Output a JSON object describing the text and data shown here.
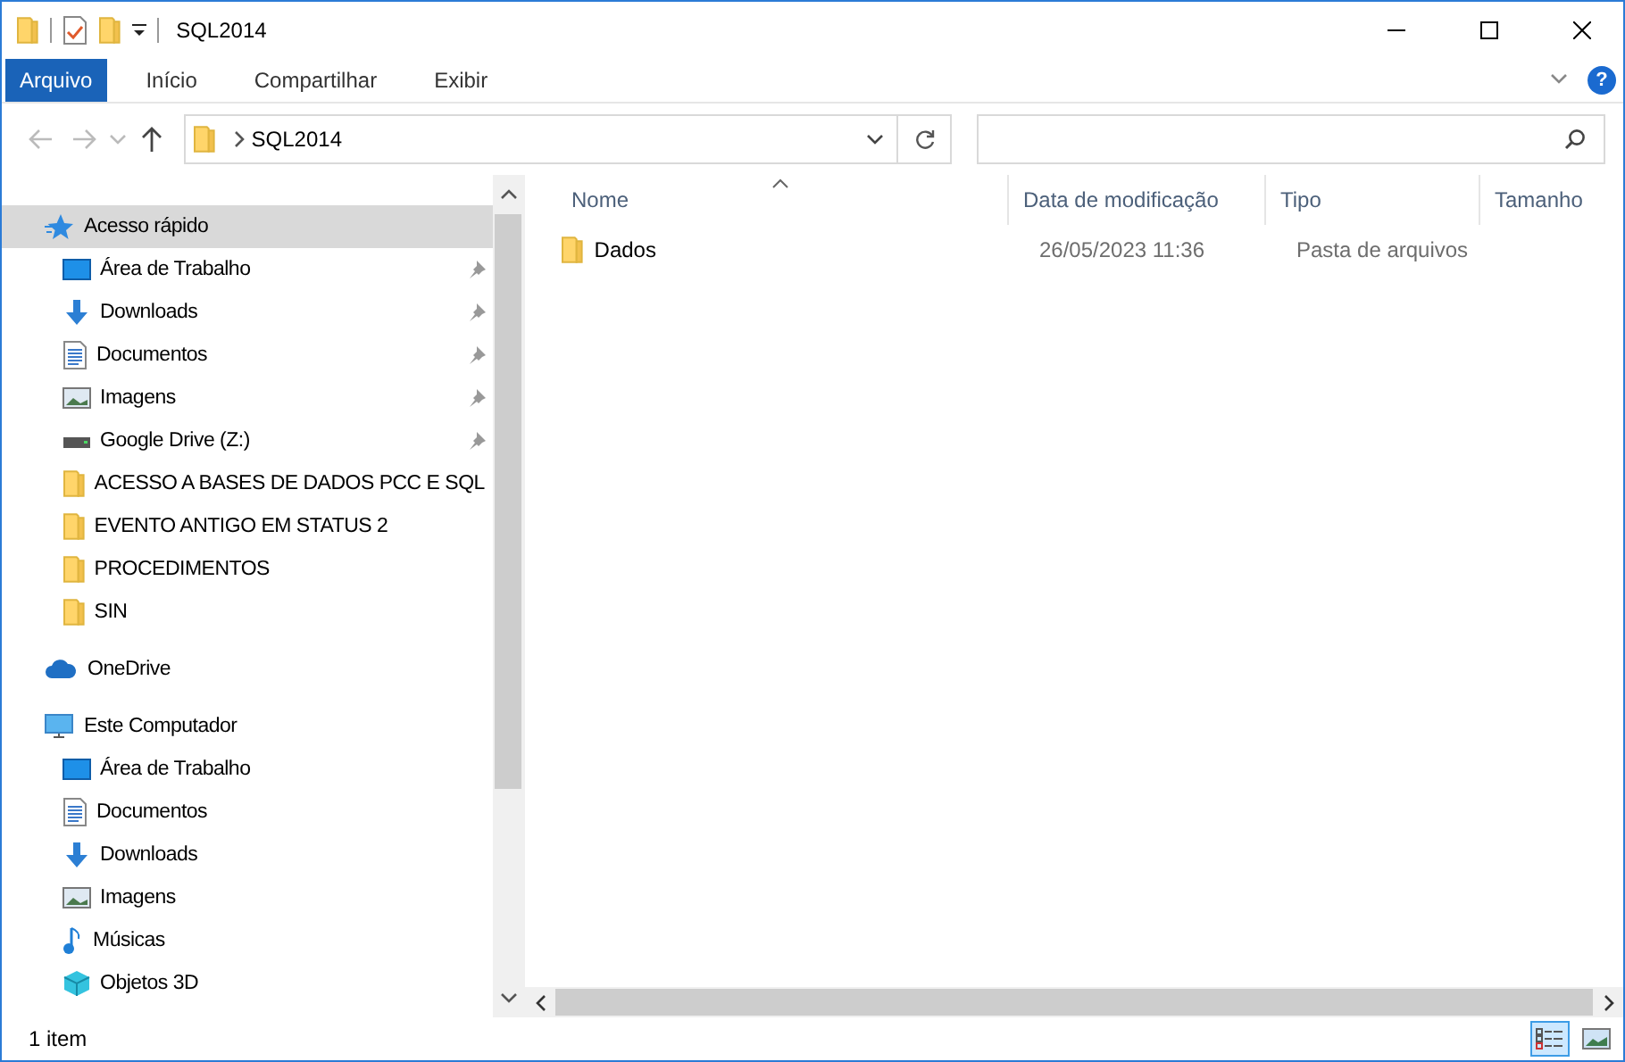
{
  "window": {
    "title": "SQL2014"
  },
  "ribbon": {
    "tabs": [
      {
        "label": "Arquivo",
        "selected": true
      },
      {
        "label": "Início",
        "selected": false
      },
      {
        "label": "Compartilhar",
        "selected": false
      },
      {
        "label": "Exibir",
        "selected": false
      }
    ],
    "help": "?"
  },
  "address": {
    "path": [
      "SQL2014"
    ]
  },
  "sidebar": {
    "sections": [
      {
        "label": "Acesso rápido",
        "kind": "star",
        "selected": true,
        "children": [
          {
            "label": "Área de Trabalho",
            "kind": "desktop",
            "pinned": true
          },
          {
            "label": "Downloads",
            "kind": "downloads",
            "pinned": true
          },
          {
            "label": "Documentos",
            "kind": "documents",
            "pinned": true
          },
          {
            "label": "Imagens",
            "kind": "pictures",
            "pinned": true
          },
          {
            "label": "Google Drive (Z:)",
            "kind": "drive",
            "pinned": true
          },
          {
            "label": "ACESSO A BASES DE DADOS PCC E SQL",
            "kind": "folder",
            "pinned": false
          },
          {
            "label": "EVENTO ANTIGO EM STATUS 2",
            "kind": "folder",
            "pinned": false
          },
          {
            "label": "PROCEDIMENTOS",
            "kind": "folder",
            "pinned": false
          },
          {
            "label": "SIN",
            "kind": "folder",
            "pinned": false
          }
        ]
      },
      {
        "label": "OneDrive",
        "kind": "cloud",
        "selected": false
      },
      {
        "label": "Este Computador",
        "kind": "computer",
        "selected": false,
        "children": [
          {
            "label": "Área de Trabalho",
            "kind": "desktop",
            "pinned": false
          },
          {
            "label": "Documentos",
            "kind": "documents",
            "pinned": false
          },
          {
            "label": "Downloads",
            "kind": "downloads",
            "pinned": false
          },
          {
            "label": "Imagens",
            "kind": "pictures",
            "pinned": false
          },
          {
            "label": "Músicas",
            "kind": "music",
            "pinned": false
          },
          {
            "label": "Objetos 3D",
            "kind": "objects3d",
            "pinned": false
          }
        ]
      }
    ]
  },
  "table": {
    "columns": [
      "Nome",
      "Data de modificação",
      "Tipo",
      "Tamanho"
    ],
    "rows": [
      {
        "name": "Dados",
        "modified": "26/05/2023 11:36",
        "type": "Pasta de arquivos",
        "selected": false
      }
    ]
  },
  "status_bar": {
    "text": "1 item",
    "views": [
      {
        "kind": "details",
        "selected": true
      },
      {
        "kind": "large",
        "selected": false
      }
    ]
  }
}
